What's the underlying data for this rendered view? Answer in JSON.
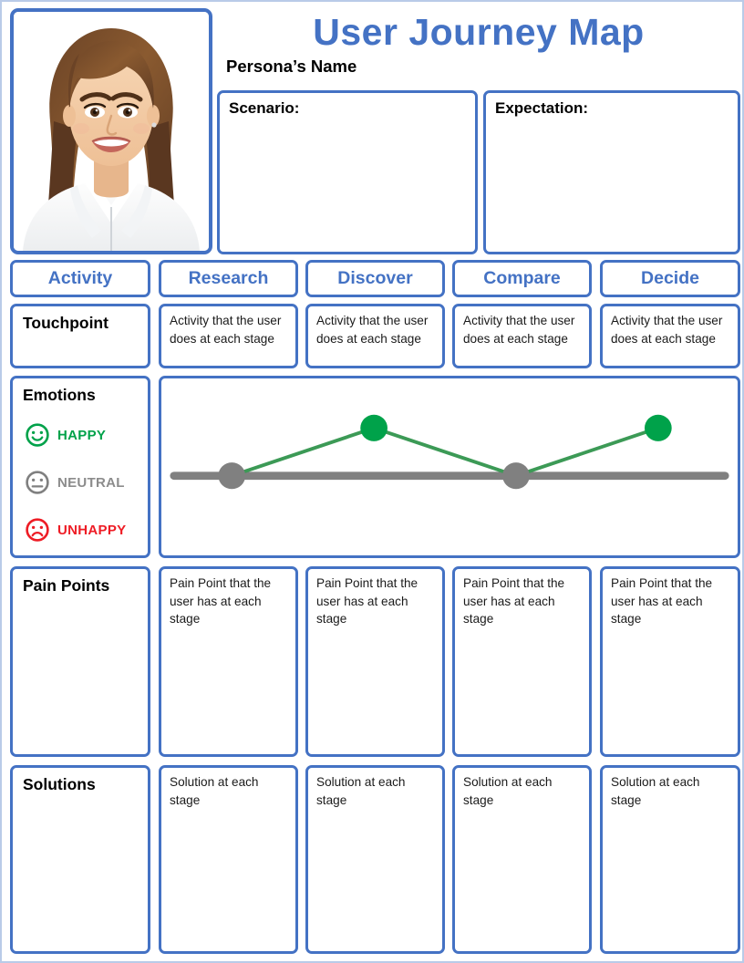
{
  "header": {
    "title": "User Journey Map",
    "persona_name": "Persona’s Name",
    "photo_alt": "persona-portrait",
    "scenario_label": "Scenario:",
    "expectation_label": "Expectation:"
  },
  "colors": {
    "accent_blue": "#4472C4",
    "page_border": "#B9CBE8",
    "happy_green": "#00A24A",
    "neutral_gray": "#808080",
    "unhappy_red": "#EE1C25",
    "text_black": "#000000"
  },
  "columns": [
    {
      "label": "Activity"
    },
    {
      "label": "Research"
    },
    {
      "label": "Discover"
    },
    {
      "label": "Compare"
    },
    {
      "label": "Decide"
    }
  ],
  "rows": [
    {
      "key": "touchpoint",
      "label": "Touchpoint",
      "cells": [
        "Activity that the user does at each stage",
        "Activity that the user does at each stage",
        "Activity that the user does at each stage",
        "Activity that the user does at each stage"
      ]
    },
    {
      "key": "pain_points",
      "label": "Pain Points",
      "cells": [
        "Pain Point that the user has at each stage",
        "Pain Point that the user has at each stage",
        "Pain Point that the user has at each stage",
        "Pain Point that the user has at each stage"
      ]
    },
    {
      "key": "solutions",
      "label": "Solutions",
      "cells": [
        "Solution at each stage",
        "Solution at each stage",
        "Solution at each stage",
        "Solution at each stage"
      ]
    }
  ],
  "emotions": {
    "label": "Emotions",
    "legend": [
      {
        "icon": "happy-face-icon",
        "label": "HAPPY",
        "color": "#00A24A"
      },
      {
        "icon": "neutral-face-icon",
        "label": "NEUTRAL",
        "color": "#808080"
      },
      {
        "icon": "unhappy-face-icon",
        "label": "UNHAPPY",
        "color": "#EE1C25"
      }
    ]
  },
  "chart_data": {
    "type": "line",
    "title": "",
    "xlabel": "",
    "ylabel": "",
    "categories": [
      "Research",
      "Discover",
      "Compare",
      "Decide"
    ],
    "series": [
      {
        "name": "Emotion",
        "values": [
          0,
          1,
          0,
          1
        ],
        "point_labels": [
          "NEUTRAL",
          "HAPPY",
          "NEUTRAL",
          "HAPPY"
        ],
        "point_colors": [
          "#808080",
          "#00A24A",
          "#808080",
          "#00A24A"
        ]
      }
    ],
    "baseline": {
      "value": 0,
      "color": "#808080",
      "label": "NEUTRAL"
    },
    "ylim": [
      0,
      1
    ],
    "grid": false,
    "legend_position": "left-panel"
  }
}
